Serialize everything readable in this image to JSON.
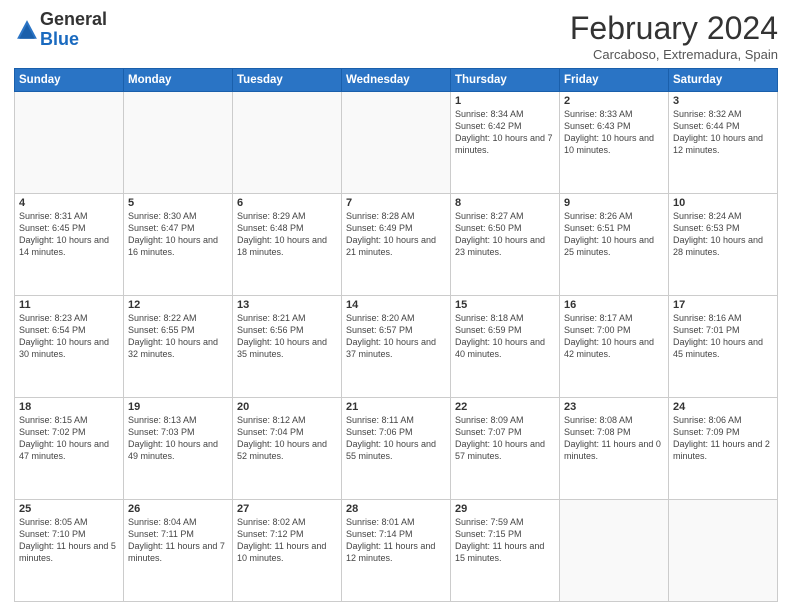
{
  "logo": {
    "general": "General",
    "blue": "Blue"
  },
  "header": {
    "title": "February 2024",
    "subtitle": "Carcaboso, Extremadura, Spain"
  },
  "days_of_week": [
    "Sunday",
    "Monday",
    "Tuesday",
    "Wednesday",
    "Thursday",
    "Friday",
    "Saturday"
  ],
  "weeks": [
    [
      {
        "day": "",
        "info": ""
      },
      {
        "day": "",
        "info": ""
      },
      {
        "day": "",
        "info": ""
      },
      {
        "day": "",
        "info": ""
      },
      {
        "day": "1",
        "info": "Sunrise: 8:34 AM\nSunset: 6:42 PM\nDaylight: 10 hours\nand 7 minutes."
      },
      {
        "day": "2",
        "info": "Sunrise: 8:33 AM\nSunset: 6:43 PM\nDaylight: 10 hours\nand 10 minutes."
      },
      {
        "day": "3",
        "info": "Sunrise: 8:32 AM\nSunset: 6:44 PM\nDaylight: 10 hours\nand 12 minutes."
      }
    ],
    [
      {
        "day": "4",
        "info": "Sunrise: 8:31 AM\nSunset: 6:45 PM\nDaylight: 10 hours\nand 14 minutes."
      },
      {
        "day": "5",
        "info": "Sunrise: 8:30 AM\nSunset: 6:47 PM\nDaylight: 10 hours\nand 16 minutes."
      },
      {
        "day": "6",
        "info": "Sunrise: 8:29 AM\nSunset: 6:48 PM\nDaylight: 10 hours\nand 18 minutes."
      },
      {
        "day": "7",
        "info": "Sunrise: 8:28 AM\nSunset: 6:49 PM\nDaylight: 10 hours\nand 21 minutes."
      },
      {
        "day": "8",
        "info": "Sunrise: 8:27 AM\nSunset: 6:50 PM\nDaylight: 10 hours\nand 23 minutes."
      },
      {
        "day": "9",
        "info": "Sunrise: 8:26 AM\nSunset: 6:51 PM\nDaylight: 10 hours\nand 25 minutes."
      },
      {
        "day": "10",
        "info": "Sunrise: 8:24 AM\nSunset: 6:53 PM\nDaylight: 10 hours\nand 28 minutes."
      }
    ],
    [
      {
        "day": "11",
        "info": "Sunrise: 8:23 AM\nSunset: 6:54 PM\nDaylight: 10 hours\nand 30 minutes."
      },
      {
        "day": "12",
        "info": "Sunrise: 8:22 AM\nSunset: 6:55 PM\nDaylight: 10 hours\nand 32 minutes."
      },
      {
        "day": "13",
        "info": "Sunrise: 8:21 AM\nSunset: 6:56 PM\nDaylight: 10 hours\nand 35 minutes."
      },
      {
        "day": "14",
        "info": "Sunrise: 8:20 AM\nSunset: 6:57 PM\nDaylight: 10 hours\nand 37 minutes."
      },
      {
        "day": "15",
        "info": "Sunrise: 8:18 AM\nSunset: 6:59 PM\nDaylight: 10 hours\nand 40 minutes."
      },
      {
        "day": "16",
        "info": "Sunrise: 8:17 AM\nSunset: 7:00 PM\nDaylight: 10 hours\nand 42 minutes."
      },
      {
        "day": "17",
        "info": "Sunrise: 8:16 AM\nSunset: 7:01 PM\nDaylight: 10 hours\nand 45 minutes."
      }
    ],
    [
      {
        "day": "18",
        "info": "Sunrise: 8:15 AM\nSunset: 7:02 PM\nDaylight: 10 hours\nand 47 minutes."
      },
      {
        "day": "19",
        "info": "Sunrise: 8:13 AM\nSunset: 7:03 PM\nDaylight: 10 hours\nand 49 minutes."
      },
      {
        "day": "20",
        "info": "Sunrise: 8:12 AM\nSunset: 7:04 PM\nDaylight: 10 hours\nand 52 minutes."
      },
      {
        "day": "21",
        "info": "Sunrise: 8:11 AM\nSunset: 7:06 PM\nDaylight: 10 hours\nand 55 minutes."
      },
      {
        "day": "22",
        "info": "Sunrise: 8:09 AM\nSunset: 7:07 PM\nDaylight: 10 hours\nand 57 minutes."
      },
      {
        "day": "23",
        "info": "Sunrise: 8:08 AM\nSunset: 7:08 PM\nDaylight: 11 hours\nand 0 minutes."
      },
      {
        "day": "24",
        "info": "Sunrise: 8:06 AM\nSunset: 7:09 PM\nDaylight: 11 hours\nand 2 minutes."
      }
    ],
    [
      {
        "day": "25",
        "info": "Sunrise: 8:05 AM\nSunset: 7:10 PM\nDaylight: 11 hours\nand 5 minutes."
      },
      {
        "day": "26",
        "info": "Sunrise: 8:04 AM\nSunset: 7:11 PM\nDaylight: 11 hours\nand 7 minutes."
      },
      {
        "day": "27",
        "info": "Sunrise: 8:02 AM\nSunset: 7:12 PM\nDaylight: 11 hours\nand 10 minutes."
      },
      {
        "day": "28",
        "info": "Sunrise: 8:01 AM\nSunset: 7:14 PM\nDaylight: 11 hours\nand 12 minutes."
      },
      {
        "day": "29",
        "info": "Sunrise: 7:59 AM\nSunset: 7:15 PM\nDaylight: 11 hours\nand 15 minutes."
      },
      {
        "day": "",
        "info": ""
      },
      {
        "day": "",
        "info": ""
      }
    ]
  ]
}
